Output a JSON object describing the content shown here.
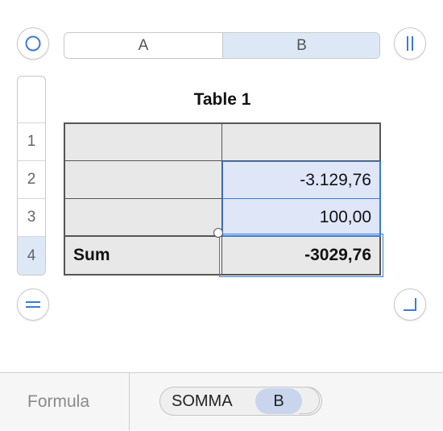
{
  "columns": [
    "A",
    "B"
  ],
  "rows": [
    "1",
    "2",
    "3",
    "4"
  ],
  "table": {
    "title": "Table 1",
    "cells": {
      "a1": "",
      "b1": "",
      "a2": "",
      "b2": "-3.129,76",
      "a3": "",
      "b3": "100,00",
      "a4": "Sum",
      "b4": "-3029,76"
    }
  },
  "formula_bar": {
    "label": "Formula",
    "function_token": "SOMMA",
    "reference_token": "B"
  },
  "colors": {
    "accent": "#3a7bd5",
    "selection_fill": "#dfe6f8",
    "token_fill": "#c9d5ec"
  }
}
